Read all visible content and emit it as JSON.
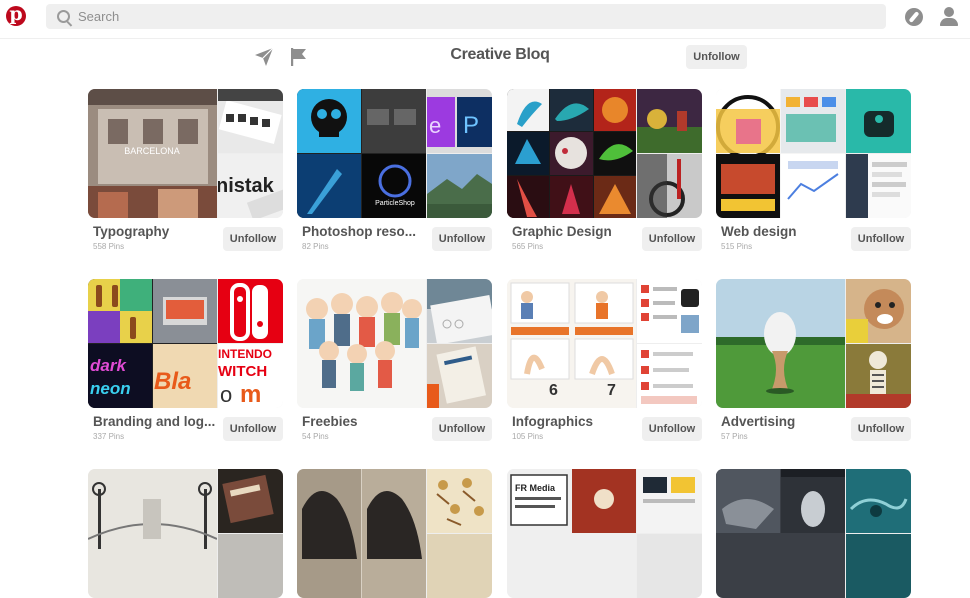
{
  "header": {
    "search_placeholder": "Search",
    "icons": [
      "pinterest-logo-icon",
      "search-icon",
      "compass-icon",
      "user-icon"
    ]
  },
  "profile": {
    "name": "Creative Bloq",
    "unfollow_label": "Unfollow",
    "icons": [
      "send-icon",
      "flag-icon"
    ]
  },
  "colors": {
    "brand": "#bd081c",
    "button_bg": "#efefef",
    "text": "#555555",
    "muted": "#a9a9a9"
  },
  "boards": [
    {
      "title": "Typography",
      "count": "558 Pins",
      "button": "Unfollow"
    },
    {
      "title": "Photoshop reso...",
      "count": "82 Pins",
      "button": "Unfollow"
    },
    {
      "title": "Graphic Design",
      "count": "565 Pins",
      "button": "Unfollow"
    },
    {
      "title": "Web design",
      "count": "515 Pins",
      "button": "Unfollow"
    },
    {
      "title": "Branding and log...",
      "count": "337 Pins",
      "button": "Unfollow"
    },
    {
      "title": "Freebies",
      "count": "54 Pins",
      "button": "Unfollow"
    },
    {
      "title": "Infographics",
      "count": "105 Pins",
      "button": "Unfollow"
    },
    {
      "title": "Advertising",
      "count": "57 Pins",
      "button": "Unfollow"
    },
    {
      "title": "",
      "count": "",
      "button": ""
    },
    {
      "title": "",
      "count": "",
      "button": ""
    },
    {
      "title": "",
      "count": "",
      "button": ""
    },
    {
      "title": "",
      "count": "",
      "button": ""
    }
  ]
}
